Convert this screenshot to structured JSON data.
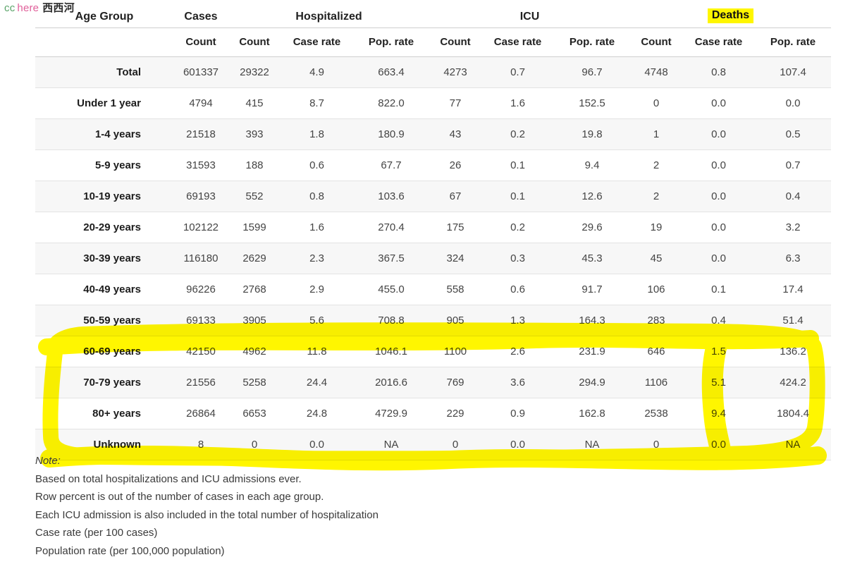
{
  "watermark": {
    "cc": "cc",
    "here": "here",
    "cn": "西西河",
    "colors": {
      "cc": "#5aa469",
      "here": "#e0609a",
      "cn": "#2c2c2c"
    }
  },
  "highlight": {
    "color": "#fff600",
    "targets": [
      "Deaths",
      "60-69 years",
      "70-79 years",
      "80+ years",
      "Unknown",
      "Deaths Case rate column"
    ]
  },
  "table": {
    "groups": [
      {
        "label": "Age Group",
        "span": 1
      },
      {
        "label": "Cases",
        "span": 1
      },
      {
        "label": "Hospitalized",
        "span": 3
      },
      {
        "label": "ICU",
        "span": 3
      },
      {
        "label": "Deaths",
        "span": 3,
        "highlighted": true
      }
    ],
    "subheaders": [
      "",
      "Count",
      "Count",
      "Case rate",
      "Pop. rate",
      "Count",
      "Case rate",
      "Pop. rate",
      "Count",
      "Case rate",
      "Pop. rate"
    ],
    "rows": [
      {
        "label": "Total",
        "cells": [
          "601337",
          "29322",
          "4.9",
          "663.4",
          "4273",
          "0.7",
          "96.7",
          "4748",
          "0.8",
          "107.4"
        ]
      },
      {
        "label": "Under 1 year",
        "cells": [
          "4794",
          "415",
          "8.7",
          "822.0",
          "77",
          "1.6",
          "152.5",
          "0",
          "0.0",
          "0.0"
        ]
      },
      {
        "label": "1-4 years",
        "cells": [
          "21518",
          "393",
          "1.8",
          "180.9",
          "43",
          "0.2",
          "19.8",
          "1",
          "0.0",
          "0.5"
        ]
      },
      {
        "label": "5-9 years",
        "cells": [
          "31593",
          "188",
          "0.6",
          "67.7",
          "26",
          "0.1",
          "9.4",
          "2",
          "0.0",
          "0.7"
        ]
      },
      {
        "label": "10-19 years",
        "cells": [
          "69193",
          "552",
          "0.8",
          "103.6",
          "67",
          "0.1",
          "12.6",
          "2",
          "0.0",
          "0.4"
        ]
      },
      {
        "label": "20-29 years",
        "cells": [
          "102122",
          "1599",
          "1.6",
          "270.4",
          "175",
          "0.2",
          "29.6",
          "19",
          "0.0",
          "3.2"
        ]
      },
      {
        "label": "30-39 years",
        "cells": [
          "116180",
          "2629",
          "2.3",
          "367.5",
          "324",
          "0.3",
          "45.3",
          "45",
          "0.0",
          "6.3"
        ]
      },
      {
        "label": "40-49 years",
        "cells": [
          "96226",
          "2768",
          "2.9",
          "455.0",
          "558",
          "0.6",
          "91.7",
          "106",
          "0.1",
          "17.4"
        ]
      },
      {
        "label": "50-59 years",
        "cells": [
          "69133",
          "3905",
          "5.6",
          "708.8",
          "905",
          "1.3",
          "164.3",
          "283",
          "0.4",
          "51.4"
        ]
      },
      {
        "label": "60-69 years",
        "cells": [
          "42150",
          "4962",
          "11.8",
          "1046.1",
          "1100",
          "2.6",
          "231.9",
          "646",
          "1.5",
          "136.2"
        ]
      },
      {
        "label": "70-79 years",
        "cells": [
          "21556",
          "5258",
          "24.4",
          "2016.6",
          "769",
          "3.6",
          "294.9",
          "1106",
          "5.1",
          "424.2"
        ]
      },
      {
        "label": "80+ years",
        "cells": [
          "26864",
          "6653",
          "24.8",
          "4729.9",
          "229",
          "0.9",
          "162.8",
          "2538",
          "9.4",
          "1804.4"
        ]
      },
      {
        "label": "Unknown",
        "cells": [
          "8",
          "0",
          "0.0",
          "NA",
          "0",
          "0.0",
          "NA",
          "0",
          "0.0",
          "NA"
        ]
      }
    ]
  },
  "notes": {
    "heading": "Note:",
    "lines": [
      "Based on total hospitalizations and ICU admissions ever.",
      "Row percent is out of the number of cases in each age group.",
      "Each ICU admission is also included in the total number of hospitalization",
      "Case rate (per 100 cases)",
      "Population rate (per 100,000 population)"
    ]
  }
}
